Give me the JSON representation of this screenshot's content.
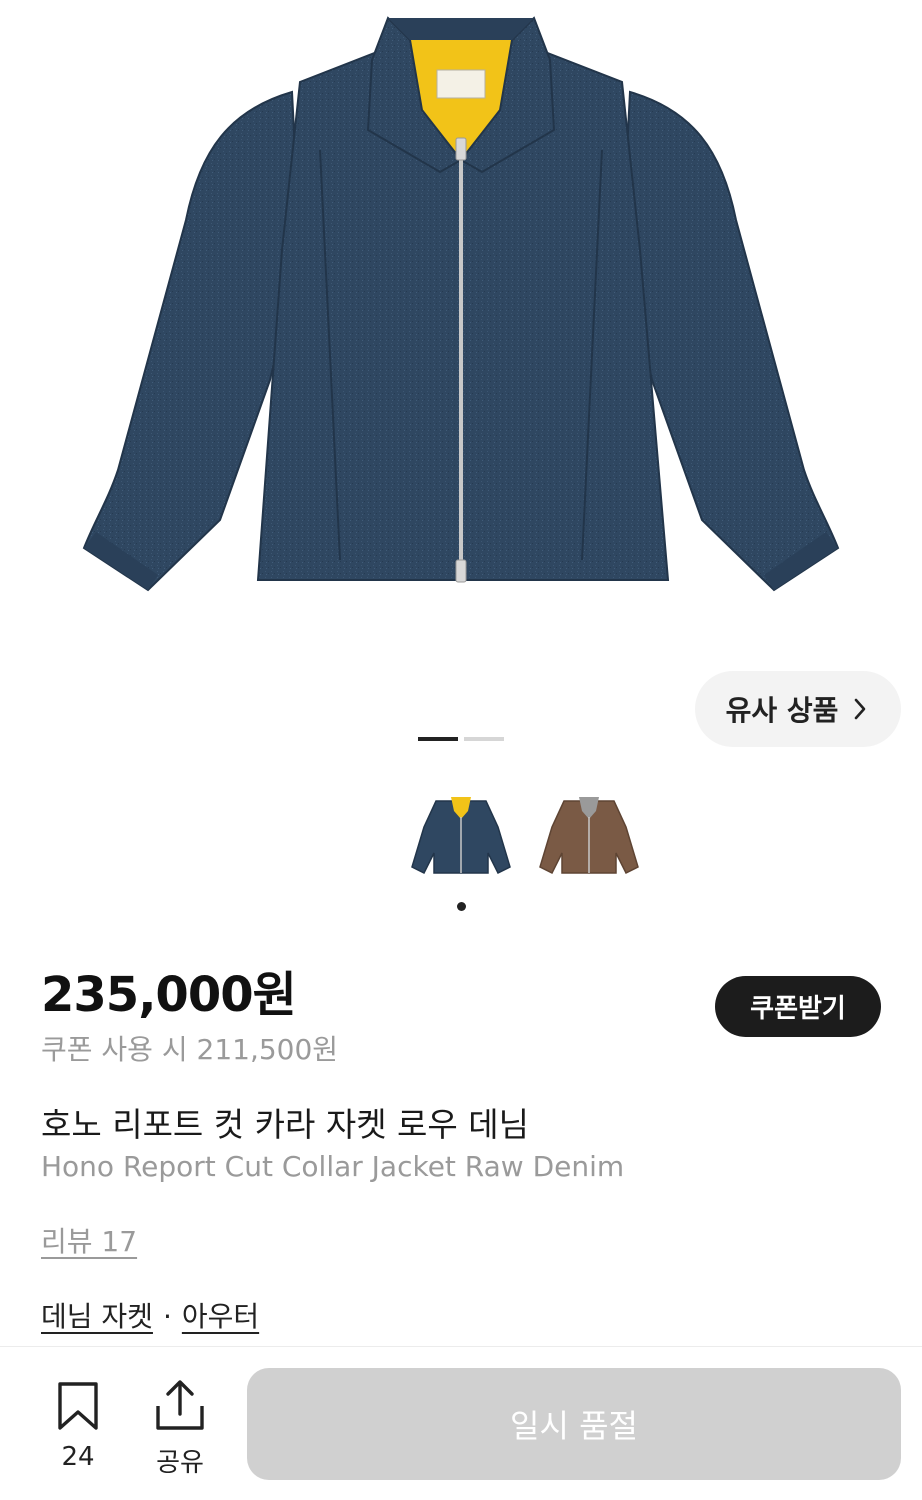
{
  "similar_products": {
    "label": "유사 상품"
  },
  "carousel": {
    "count": 2,
    "active": 0
  },
  "color_options": [
    {
      "name": "navy",
      "color": "#2f4761",
      "selected": true
    },
    {
      "name": "brown",
      "color": "#7a5a45",
      "selected": false
    }
  ],
  "price": {
    "main": "235,000원",
    "coupon_text": "쿠폰 사용 시 211,500원"
  },
  "coupon_button": {
    "label": "쿠폰받기"
  },
  "product": {
    "name_ko": "호노 리포트 컷 카라 자켓 로우 데님",
    "name_en": "Hono Report Cut Collar Jacket Raw Denim"
  },
  "reviews": {
    "label": "리뷰 17"
  },
  "categories": {
    "items": [
      "데님 자켓",
      "아우터"
    ],
    "separator": "·"
  },
  "bottom_bar": {
    "bookmark_count": "24",
    "share_label": "공유",
    "soldout_label": "일시 품절"
  },
  "colors": {
    "jacket_navy": "#2f4761",
    "lining_yellow": "#f2c318",
    "jacket_brown": "#7a5a45",
    "soldout_bg": "#d0d0d0",
    "coupon_bg": "#1c1c1c"
  }
}
